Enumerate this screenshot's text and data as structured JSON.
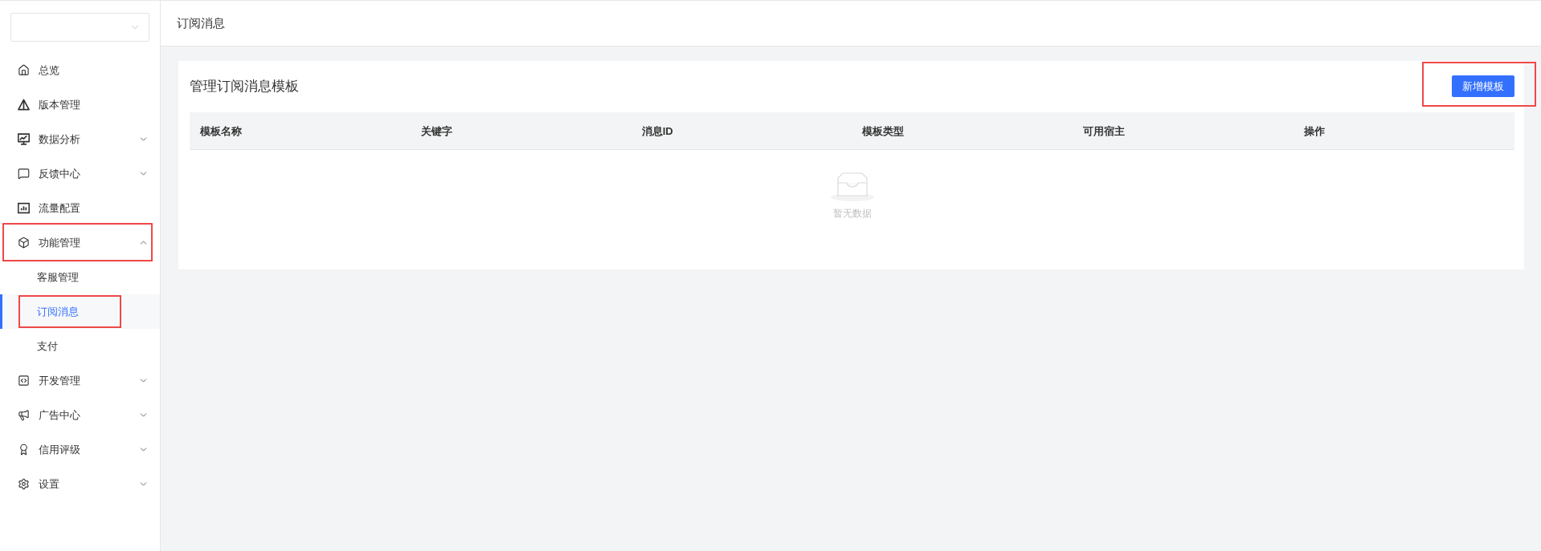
{
  "sidebar": {
    "menu": [
      {
        "kind": "link",
        "label": "总览",
        "selected": false,
        "annotated": false
      },
      {
        "kind": "link",
        "label": "版本管理",
        "selected": false,
        "annotated": false
      },
      {
        "kind": "group",
        "label": "数据分析",
        "expanded": false,
        "annotated": false
      },
      {
        "kind": "group",
        "label": "反馈中心",
        "expanded": false,
        "annotated": false
      },
      {
        "kind": "link",
        "label": "流量配置",
        "selected": false,
        "annotated": false
      },
      {
        "kind": "group",
        "label": "功能管理",
        "expanded": true,
        "annotated": true,
        "children": [
          {
            "label": "客服管理",
            "selected": false,
            "annotated": false
          },
          {
            "label": "订阅消息",
            "selected": true,
            "annotated": true
          },
          {
            "label": "支付",
            "selected": false,
            "annotated": false
          }
        ]
      },
      {
        "kind": "group",
        "label": "开发管理",
        "expanded": false,
        "annotated": false
      },
      {
        "kind": "group",
        "label": "广告中心",
        "expanded": false,
        "annotated": false
      },
      {
        "kind": "group",
        "label": "信用评级",
        "expanded": false,
        "annotated": false
      },
      {
        "kind": "group",
        "label": "设置",
        "expanded": false,
        "annotated": false
      }
    ]
  },
  "header": {
    "title": "订阅消息"
  },
  "card": {
    "title": "管理订阅消息模板",
    "button": {
      "label": "新增模板",
      "annotated": true
    },
    "table": {
      "columns": [
        "模板名称",
        "关键字",
        "消息ID",
        "模板类型",
        "可用宿主",
        "操作"
      ],
      "empty_text": "暂无数据"
    }
  }
}
